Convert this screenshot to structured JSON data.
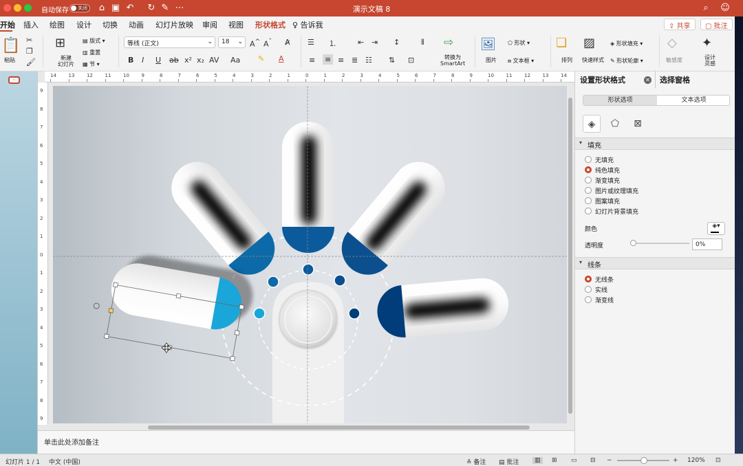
{
  "titlebar": {
    "autosave": "自动保存",
    "toggle": "关闭",
    "title": "演示文稿 8"
  },
  "tabs": [
    "开始",
    "插入",
    "绘图",
    "设计",
    "切换",
    "动画",
    "幻灯片放映",
    "审阅",
    "视图",
    "形状格式"
  ],
  "tellme": "告诉我",
  "share": "共享",
  "comments": "批注",
  "ribbon": {
    "paste": "粘贴",
    "new_slide": "新建\n幻灯片",
    "layout": "版式",
    "reset": "重置",
    "section": "节",
    "font": "等线 (正文)",
    "size": "18",
    "convert": "转换为\nSmartArt",
    "picture": "图片",
    "shape": "形状",
    "textbox": "文本框",
    "arrange": "排列",
    "quick_styles": "快速样式",
    "shape_fill": "形状填充",
    "shape_outline": "形状轮廓",
    "sensitivity": "敏感度",
    "designer": "设计\n灵感"
  },
  "panel": {
    "title": "设置形状格式",
    "pane2": "选择窗格",
    "tab1": "形状选项",
    "tab2": "文本选项",
    "fill_section": "填充",
    "fill_options": [
      "无填充",
      "纯色填充",
      "渐变填充",
      "图片或纹理填充",
      "图案填充",
      "幻灯片背景填充"
    ],
    "fill_selected": "纯色填充",
    "color_label": "颜色",
    "transparency_label": "透明度",
    "transparency": "0%",
    "line_section": "线条",
    "line_options": [
      "无线条",
      "实线",
      "渐变线"
    ],
    "line_selected": "无线条"
  },
  "notes": "单击此处添加备注",
  "status": {
    "slide": "幻灯片 1 / 1",
    "lang": "中文 (中国)",
    "notes_btn": "备注",
    "comments_btn": "批注",
    "zoom": "120%"
  },
  "ruler_h": [
    "14",
    "13",
    "12",
    "11",
    "10",
    "9",
    "8",
    "7",
    "6",
    "5",
    "4",
    "3",
    "2",
    "1",
    "0",
    "1",
    "2",
    "3",
    "4",
    "5",
    "6",
    "7",
    "8",
    "9",
    "10",
    "11",
    "12",
    "13",
    "14"
  ],
  "colors": {
    "accent": "#c6462f",
    "blue_dark": "#003d7a",
    "blue_mid": "#0b5a9c",
    "cyan": "#1aa6d8"
  }
}
